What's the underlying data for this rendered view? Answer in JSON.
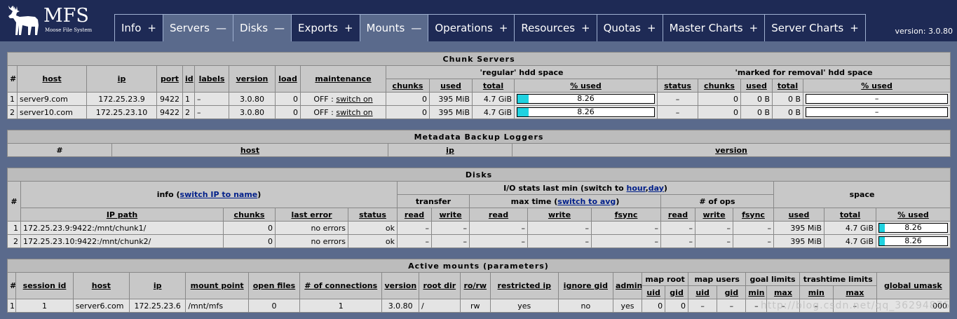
{
  "header": {
    "logo_text": "MFS",
    "logo_subtitle": "Moose File System",
    "version": "version: 3.0.80",
    "tabs": [
      {
        "label": "Info",
        "sign": "+",
        "active": false
      },
      {
        "label": "Servers",
        "sign": "—",
        "active": true
      },
      {
        "label": "Disks",
        "sign": "—",
        "active": true
      },
      {
        "label": "Exports",
        "sign": "+",
        "active": false
      },
      {
        "label": "Mounts",
        "sign": "—",
        "active": true
      },
      {
        "label": "Operations",
        "sign": "+",
        "active": false
      },
      {
        "label": "Resources",
        "sign": "+",
        "active": false
      },
      {
        "label": "Quotas",
        "sign": "+",
        "active": false
      },
      {
        "label": "Master Charts",
        "sign": "+",
        "active": false
      },
      {
        "label": "Server Charts",
        "sign": "+",
        "active": false
      }
    ]
  },
  "chunk_servers": {
    "title": "Chunk Servers",
    "headers": {
      "num": "#",
      "host": "host",
      "ip": "ip",
      "port": "port",
      "id": "id",
      "labels": "labels",
      "version": "version",
      "load": "load",
      "maintenance": "maintenance",
      "regular": "'regular' hdd space",
      "removal": "'marked for removal' hdd space",
      "chunks": "chunks",
      "used": "used",
      "total": "total",
      "pct_used": "% used",
      "status": "status"
    },
    "rows": [
      {
        "num": "1",
        "host": "server9.com",
        "ip": "172.25.23.9",
        "port": "9422",
        "id": "1",
        "labels": "–",
        "version": "3.0.80",
        "load": "0",
        "maint_state": "OFF",
        "maint_sep": ":",
        "maint_link": "switch on",
        "chunks": "0",
        "used": "395 MiB",
        "total": "4.7 GiB",
        "pct": "8.26",
        "r_status": "–",
        "r_chunks": "0",
        "r_used": "0 B",
        "r_total": "0 B",
        "r_pct": "–"
      },
      {
        "num": "2",
        "host": "server10.com",
        "ip": "172.25.23.10",
        "port": "9422",
        "id": "2",
        "labels": "–",
        "version": "3.0.80",
        "load": "0",
        "maint_state": "OFF",
        "maint_sep": ":",
        "maint_link": "switch on",
        "chunks": "0",
        "used": "395 MiB",
        "total": "4.7 GiB",
        "pct": "8.26",
        "r_status": "–",
        "r_chunks": "0",
        "r_used": "0 B",
        "r_total": "0 B",
        "r_pct": "–"
      }
    ]
  },
  "metadata_loggers": {
    "title": "Metadata Backup Loggers",
    "headers": {
      "num": "#",
      "host": "host",
      "ip": "ip",
      "version": "version"
    }
  },
  "disks": {
    "title": "Disks",
    "headers": {
      "num": "#",
      "info_prefix": "info (",
      "info_link": "switch IP to name",
      "info_suffix": ")",
      "io_prefix": "I/O stats last min (switch to ",
      "io_link_hour": "hour",
      "io_comma": ",",
      "io_link_day": "day",
      "io_suffix": ")",
      "space": "space",
      "transfer": "transfer",
      "maxtime_prefix": "max time (",
      "maxtime_link": "switch to avg",
      "maxtime_suffix": ")",
      "ops": "# of ops",
      "ip_path": "IP path",
      "chunks": "chunks",
      "last_error": "last error",
      "status": "status",
      "read": "read",
      "write": "write",
      "fsync": "fsync",
      "used": "used",
      "total": "total",
      "pct_used": "% used"
    },
    "rows": [
      {
        "num": "1",
        "path": "172.25.23.9:9422:/mnt/chunk1/",
        "chunks": "0",
        "last_error": "no errors",
        "status": "ok",
        "t_read": "–",
        "t_write": "–",
        "m_read": "–",
        "m_write": "–",
        "m_fsync": "–",
        "o_read": "–",
        "o_write": "–",
        "o_fsync": "–",
        "used": "395 MiB",
        "total": "4.7 GiB",
        "pct": "8.26"
      },
      {
        "num": "2",
        "path": "172.25.23.10:9422:/mnt/chunk2/",
        "chunks": "0",
        "last_error": "no errors",
        "status": "ok",
        "t_read": "–",
        "t_write": "–",
        "m_read": "–",
        "m_write": "–",
        "m_fsync": "–",
        "o_read": "–",
        "o_write": "–",
        "o_fsync": "–",
        "used": "395 MiB",
        "total": "4.7 GiB",
        "pct": "8.26"
      }
    ]
  },
  "mounts": {
    "title": "Active mounts (parameters)",
    "headers": {
      "num": "#",
      "session_id": "session id",
      "host": "host",
      "ip": "ip",
      "mount_point": "mount point",
      "open_files": "open files",
      "connections": "# of connections",
      "version": "version",
      "root_dir": "root dir",
      "rorw": "ro/rw",
      "restricted_ip": "restricted ip",
      "ignore_gid": "ignore gid",
      "admin": "admin",
      "map_root": "map root",
      "map_users": "map users",
      "goal_limits": "goal limits",
      "trashtime_limits": "trashtime limits",
      "global_umask": "global umask",
      "uid": "uid",
      "gid": "gid",
      "min": "min",
      "max": "max"
    },
    "rows": [
      {
        "num": "1",
        "session_id": "1",
        "host": "server6.com",
        "ip": "172.25.23.6",
        "mount_point": "/mnt/mfs",
        "open_files": "0",
        "connections": "1",
        "version": "3.0.80",
        "root_dir": "/",
        "rorw": "rw",
        "restricted_ip": "yes",
        "ignore_gid": "no",
        "admin": "yes",
        "mr_uid": "0",
        "mr_gid": "0",
        "mu_uid": "–",
        "mu_gid": "–",
        "g_min": "–",
        "g_max": "–",
        "t_min": "–",
        "t_max": "–",
        "umask": "000"
      }
    ]
  },
  "watermark": "http://blog.csdn.net/qq_36294875"
}
